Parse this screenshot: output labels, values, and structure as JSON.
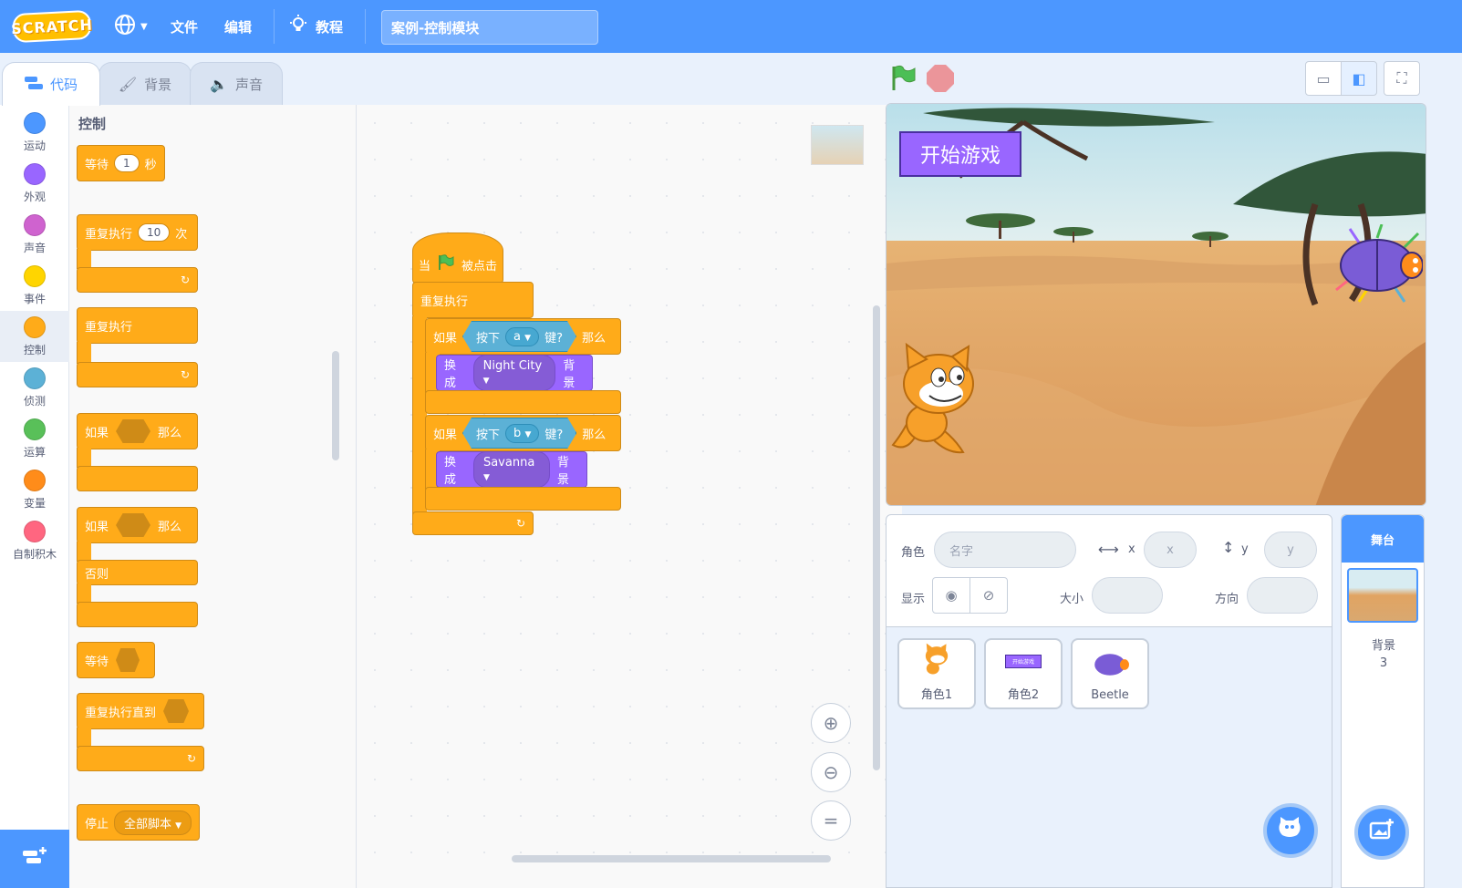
{
  "menubar": {
    "logo": "SCRATCH",
    "file": "文件",
    "edit": "编辑",
    "tutorials": "教程",
    "project_title": "案例-控制模块"
  },
  "tabs": {
    "code": "代码",
    "costumes": "背景",
    "sounds": "声音"
  },
  "categories": [
    {
      "label": "运动",
      "color": "#4c97ff"
    },
    {
      "label": "外观",
      "color": "#9966ff"
    },
    {
      "label": "声音",
      "color": "#cf63cf"
    },
    {
      "label": "事件",
      "color": "#ffd500"
    },
    {
      "label": "控制",
      "color": "#ffab19"
    },
    {
      "label": "侦测",
      "color": "#5cb1d6"
    },
    {
      "label": "运算",
      "color": "#59c059"
    },
    {
      "label": "变量",
      "color": "#ff8c1a"
    },
    {
      "label": "自制积木",
      "color": "#ff6680"
    }
  ],
  "palette": {
    "title": "控制",
    "wait": "等待",
    "wait_value": "1",
    "seconds": "秒",
    "repeat": "重复执行",
    "repeat_value": "10",
    "times": "次",
    "forever": "重复执行",
    "if": "如果",
    "then": "那么",
    "if2": "如果",
    "then2": "那么",
    "else": "否则",
    "wait_until": "等待",
    "repeat_until": "重复执行直到",
    "stop": "停止",
    "stop_option": "全部脚本"
  },
  "script": {
    "when": "当",
    "clicked": "被点击",
    "forever": "重复执行",
    "if1": "如果",
    "key_pressed": "按下",
    "key1": "a",
    "key_q": "键?",
    "then1": "那么",
    "switch1": "换成",
    "backdrop1": "Night City",
    "backdrop_word1": "背景",
    "if2": "如果",
    "key2": "b",
    "then2": "那么",
    "switch2": "换成",
    "backdrop2": "Savanna",
    "backdrop_word2": "背景"
  },
  "stage": {
    "title_sprite": "开始游戏"
  },
  "sprite_info": {
    "sprite_label": "角色",
    "name_placeholder": "名字",
    "x_label": "x",
    "x_placeholder": "x",
    "y_label": "y",
    "y_placeholder": "y",
    "show_label": "显示",
    "size_label": "大小",
    "direction_label": "方向"
  },
  "sprites": [
    {
      "name": "角色1"
    },
    {
      "name": "角色2",
      "thumb_text": "开始游戏"
    },
    {
      "name": "Beetle"
    }
  ],
  "stage_panel": {
    "title": "舞台",
    "backdrops_label": "背景",
    "backdrops_count": "3"
  }
}
